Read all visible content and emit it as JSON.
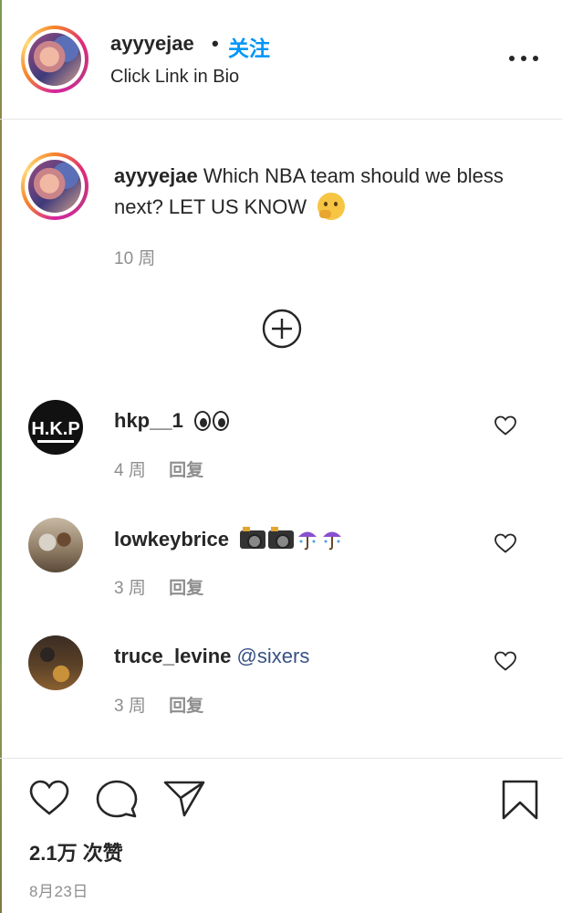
{
  "header": {
    "username": "ayyyejae",
    "separator": "•",
    "follow_label": "关注",
    "subtitle": "Click Link in Bio",
    "more_icon": "more-horizontal-icon"
  },
  "caption": {
    "username": "ayyyejae",
    "text": "Which NBA team should we bless next? LET US KNOW",
    "emoji": "thinking-face",
    "time": "10 周"
  },
  "load_more_icon": "plus-circle-icon",
  "comments": [
    {
      "username": "hkp__1",
      "text": "",
      "emoji": "eyes",
      "time": "4 周",
      "reply_label": "回复",
      "avatar_text": "H.K.P"
    },
    {
      "username": "lowkeybrice",
      "text": "",
      "emoji": "camera-flash camera-flash umbrella-rain umbrella-rain",
      "time": "3 周",
      "reply_label": "回复"
    },
    {
      "username": "truce_levine",
      "text": "",
      "mention": "@sixers",
      "time": "3 周",
      "reply_label": "回复"
    }
  ],
  "actions": {
    "like_icon": "heart-icon",
    "comment_icon": "comment-icon",
    "share_icon": "send-icon",
    "save_icon": "bookmark-icon"
  },
  "likes": "2.1万 次赞",
  "date": "8月23日",
  "colors": {
    "follow": "#0095f6",
    "mention": "#385185",
    "meta": "#8e8e8e",
    "text": "#262626"
  }
}
